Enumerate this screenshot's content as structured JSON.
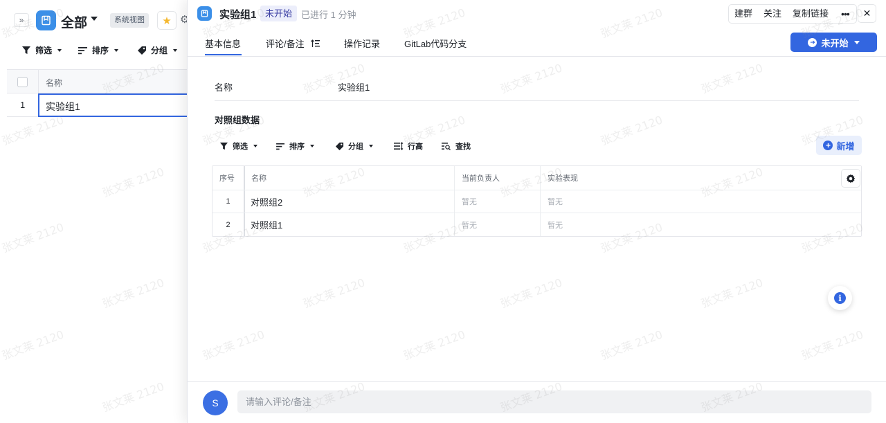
{
  "background_page": {
    "collapse_icon": "double-chevron-right",
    "view_title": "全部",
    "system_badge": "系统视图",
    "toolbar": {
      "filter": "筛选",
      "sort": "排序",
      "group": "分组"
    },
    "table": {
      "header_name": "名称",
      "rows": [
        {
          "num": "1",
          "name": "实验组1"
        }
      ]
    }
  },
  "drawer": {
    "title": "实验组1",
    "status_badge": "未开始",
    "elapsed": "已进行 1 分钟",
    "actions": [
      "建群",
      "关注",
      "复制链接"
    ],
    "more": "•••",
    "close": "✕",
    "tabs": [
      "基本信息",
      "评论/备注",
      "操作记录",
      "GitLab代码分支"
    ],
    "status_button": "未开始",
    "fields": {
      "name_label": "名称",
      "name_value": "实验组1"
    },
    "section_title": "对照组数据",
    "sub_toolbar": {
      "filter": "筛选",
      "sort": "排序",
      "group": "分组",
      "row_height": "行高",
      "find": "查找",
      "new": "新增"
    },
    "sub_table": {
      "headers": [
        "序号",
        "名称",
        "当前负责人",
        "实验表现"
      ],
      "rows": [
        {
          "num": "1",
          "name": "对照组2",
          "owner": "暂无",
          "performance": "暂无"
        },
        {
          "num": "2",
          "name": "对照组1",
          "owner": "暂无",
          "performance": "暂无"
        }
      ]
    },
    "footer": {
      "avatar_letter": "S",
      "comment_placeholder": "请输入评论/备注"
    }
  },
  "watermark_text": "张文莱 2120",
  "colors": {
    "accent": "#3366e0",
    "view_icon": "#3b8fe8",
    "status_badge_bg": "#eceefb"
  }
}
